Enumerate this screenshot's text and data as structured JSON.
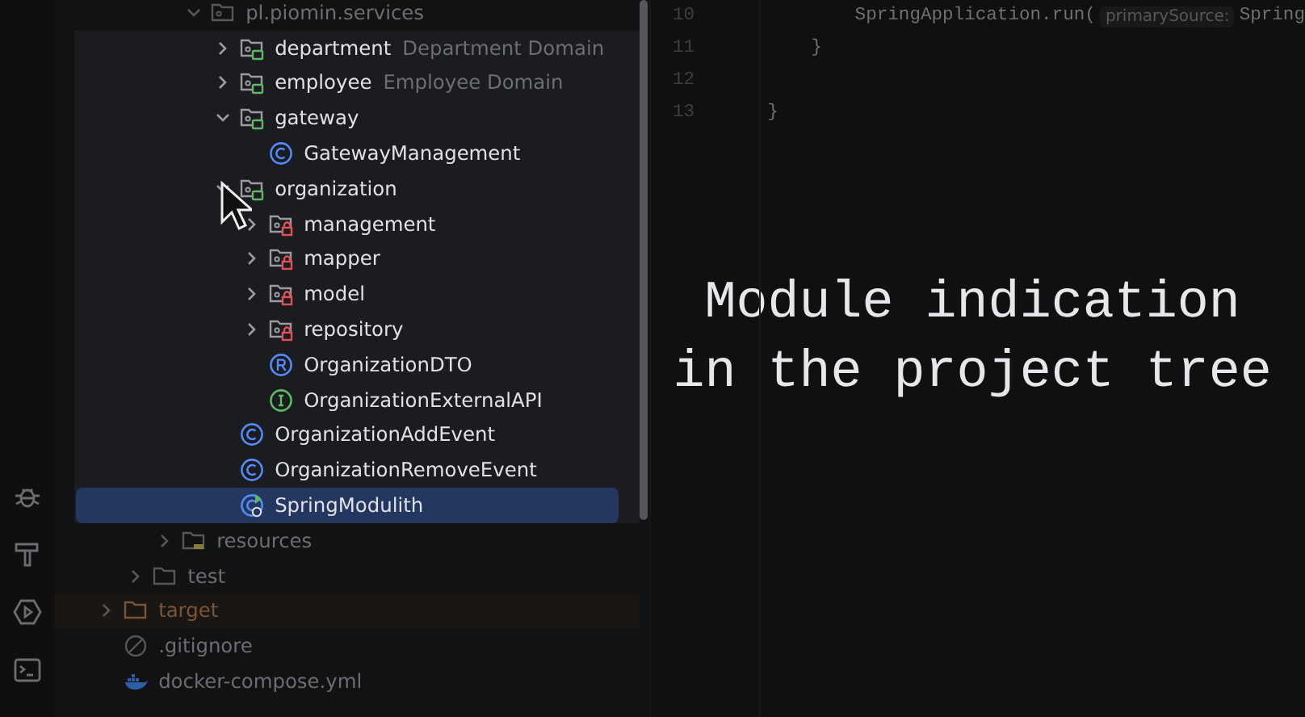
{
  "tool_strip": [
    {
      "kind": "debug"
    },
    {
      "kind": "build"
    },
    {
      "kind": "services"
    },
    {
      "kind": "terminal"
    }
  ],
  "project_tree": [
    {
      "kind": "package",
      "label": "pl.piomin.services",
      "expanded": true,
      "selected": false,
      "spotlight": true,
      "children": [
        {
          "kind": "module",
          "label": "department",
          "hint": "Department Domain",
          "expanded": false,
          "selected": false
        },
        {
          "kind": "module",
          "label": "employee",
          "hint": "Employee Domain",
          "expanded": false,
          "selected": false
        },
        {
          "kind": "module",
          "label": "gateway",
          "expanded": true,
          "selected": false,
          "children": [
            {
              "kind": "class",
              "label": "GatewayManagement",
              "selected": false
            }
          ]
        },
        {
          "kind": "module",
          "label": "organization",
          "expanded": true,
          "selected": false,
          "children": [
            {
              "kind": "internal",
              "label": "management",
              "expanded": false,
              "selected": false
            },
            {
              "kind": "internal",
              "label": "mapper",
              "expanded": false,
              "selected": false
            },
            {
              "kind": "internal",
              "label": "model",
              "expanded": false,
              "selected": false
            },
            {
              "kind": "internal",
              "label": "repository",
              "expanded": false,
              "selected": false
            },
            {
              "kind": "record",
              "label": "OrganizationDTO",
              "selected": false
            },
            {
              "kind": "interface",
              "label": "OrganizationExternalAPI",
              "selected": false
            }
          ]
        },
        {
          "kind": "class",
          "label": "OrganizationAddEvent",
          "selected": false
        },
        {
          "kind": "class",
          "label": "OrganizationRemoveEvent",
          "selected": false
        },
        {
          "kind": "app",
          "label": "SpringModulith",
          "selected": true
        }
      ]
    },
    {
      "kind": "resources",
      "label": "resources",
      "expanded": false,
      "selected": false
    },
    {
      "kind": "folder",
      "label": "test",
      "expanded": false,
      "selected": false
    },
    {
      "kind": "excluded",
      "label": "target",
      "expanded": false,
      "selected": false
    },
    {
      "kind": "ignore",
      "label": ".gitignore",
      "selected": false
    },
    {
      "kind": "docker",
      "label": "docker-compose.yml",
      "selected": false
    }
  ],
  "editor": {
    "lines": [
      {
        "number": "10",
        "code": "        SpringApplication.run(",
        "hint": "primarySource:",
        "rest": "Spring"
      },
      {
        "number": "11",
        "code": "    }"
      },
      {
        "number": "12"
      },
      {
        "number": "13",
        "code": "}"
      }
    ]
  },
  "caption": [
    "Module indication",
    "in the project tree"
  ]
}
